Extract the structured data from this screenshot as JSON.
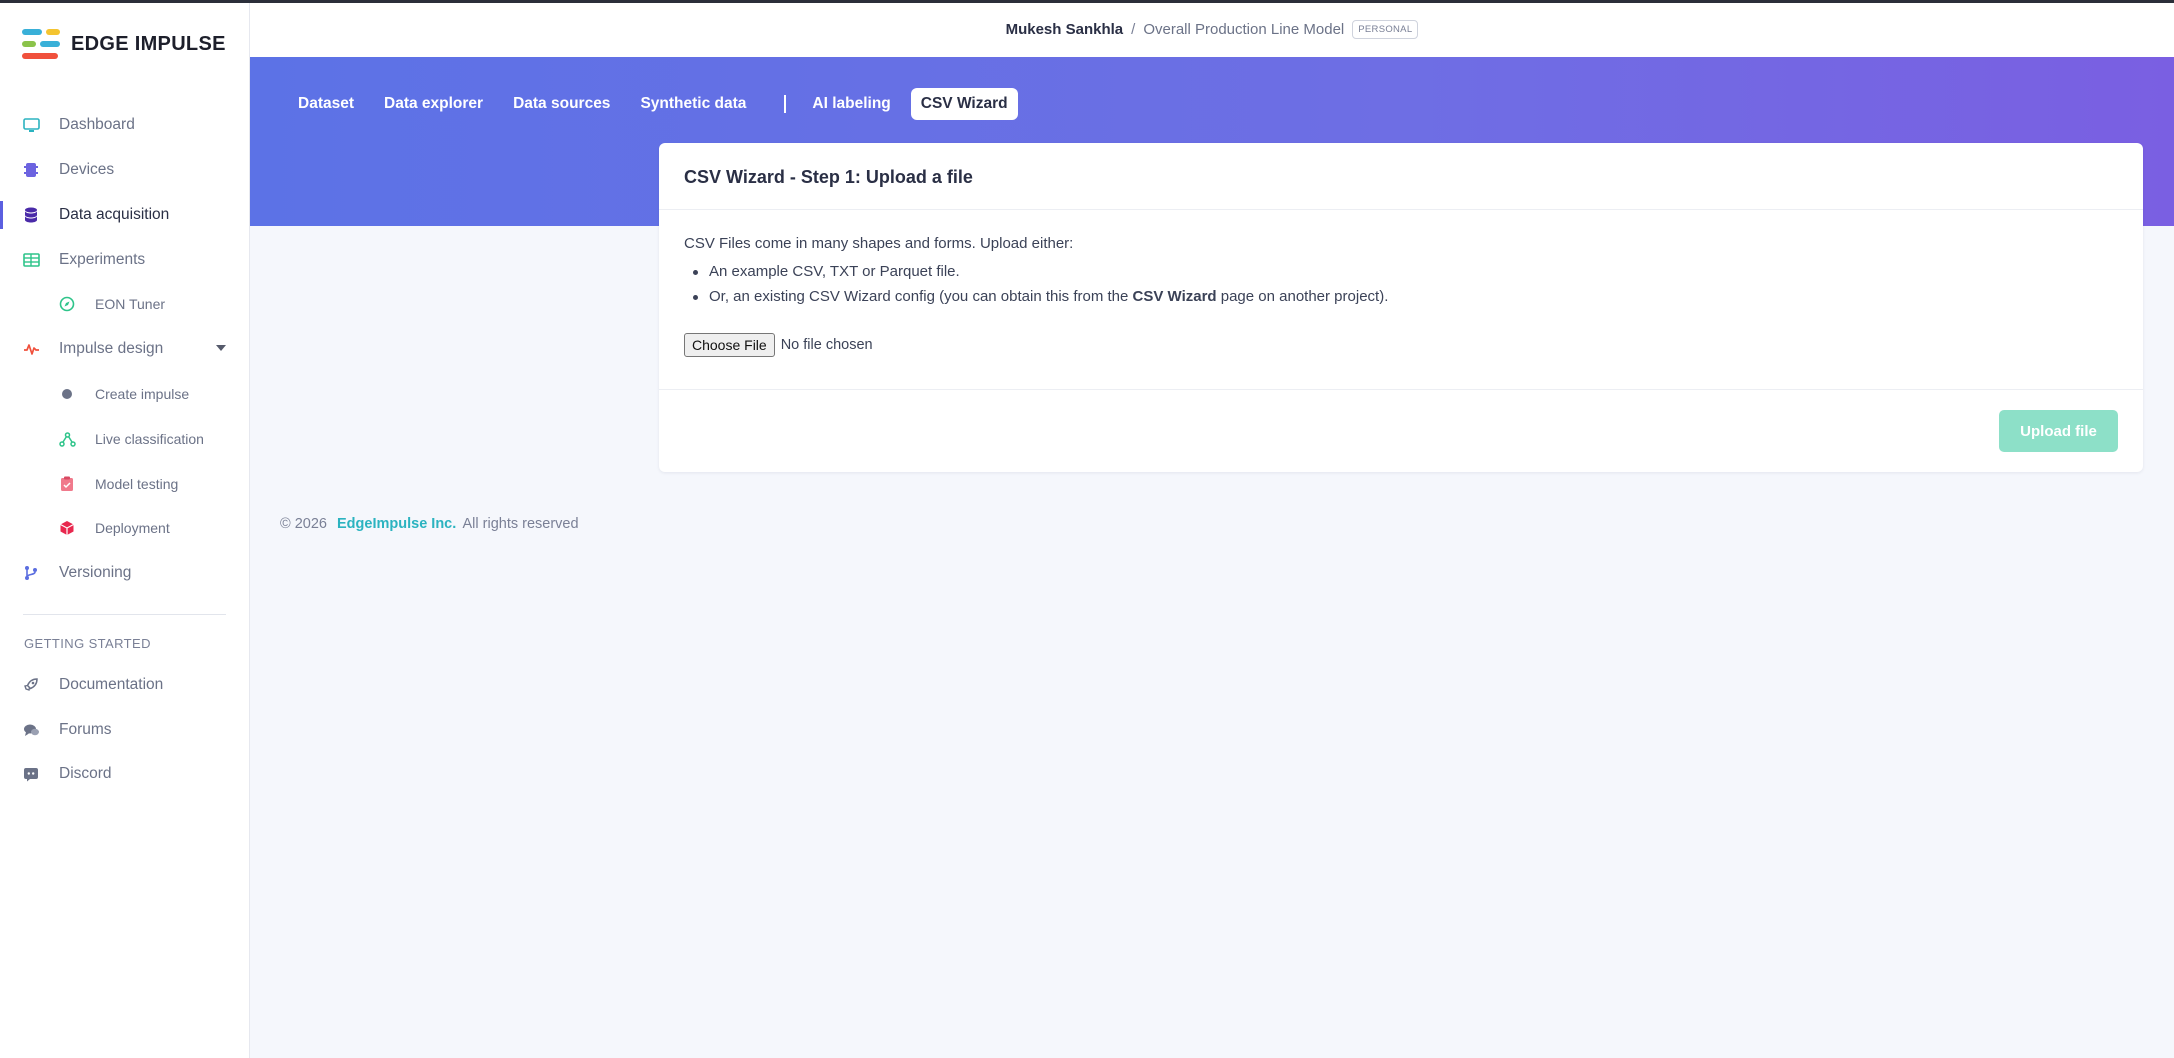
{
  "app": {
    "brand": "EDGE IMPULSE"
  },
  "sidebar": {
    "items": [
      {
        "label": "Dashboard",
        "icon": "monitor-icon"
      },
      {
        "label": "Devices",
        "icon": "chip-icon"
      },
      {
        "label": "Data acquisition",
        "icon": "database-icon",
        "active": true
      },
      {
        "label": "Experiments",
        "icon": "table-icon"
      },
      {
        "label": "EON Tuner",
        "icon": "compass-icon"
      },
      {
        "label": "Impulse design",
        "icon": "pulse-icon"
      },
      {
        "label": "Create impulse",
        "icon": "dot-icon"
      },
      {
        "label": "Live classification",
        "icon": "network-icon"
      },
      {
        "label": "Model testing",
        "icon": "clipboard-icon"
      },
      {
        "label": "Deployment",
        "icon": "box-icon"
      },
      {
        "label": "Versioning",
        "icon": "branch-icon"
      }
    ],
    "section_title": "GETTING STARTED",
    "help_items": [
      {
        "label": "Documentation",
        "icon": "rocket-icon"
      },
      {
        "label": "Forums",
        "icon": "chat-icon"
      },
      {
        "label": "Discord",
        "icon": "discord-icon"
      }
    ]
  },
  "header": {
    "owner": "Mukesh Sankhla",
    "separator": "/",
    "project": "Overall Production Line Model",
    "badge": "PERSONAL"
  },
  "tabs": [
    {
      "label": "Dataset"
    },
    {
      "label": "Data explorer"
    },
    {
      "label": "Data sources"
    },
    {
      "label": "Synthetic data"
    },
    {
      "label": "AI labeling"
    },
    {
      "label": "CSV Wizard",
      "active": true
    }
  ],
  "card": {
    "title": "CSV Wizard - Step 1: Upload a file",
    "intro": "CSV Files come in many shapes and forms. Upload either:",
    "bullet1": "An example CSV, TXT or Parquet file.",
    "bullet2_pre": "Or, an existing CSV Wizard config (you can obtain this from the ",
    "bullet2_bold": "CSV Wizard",
    "bullet2_post": " page on another project).",
    "choose_file": "Choose File",
    "no_file": "No file chosen",
    "upload_button": "Upload file"
  },
  "footer": {
    "copyright": "© 2026",
    "company": "EdgeImpulse Inc.",
    "rights": "All rights reserved"
  },
  "colors": {
    "accent": "#5b5fe0",
    "hero_start": "#5c72e6",
    "hero_end": "#7a5fe2",
    "upload_disabled": "#8de0c8",
    "link": "#2bb3c0"
  }
}
